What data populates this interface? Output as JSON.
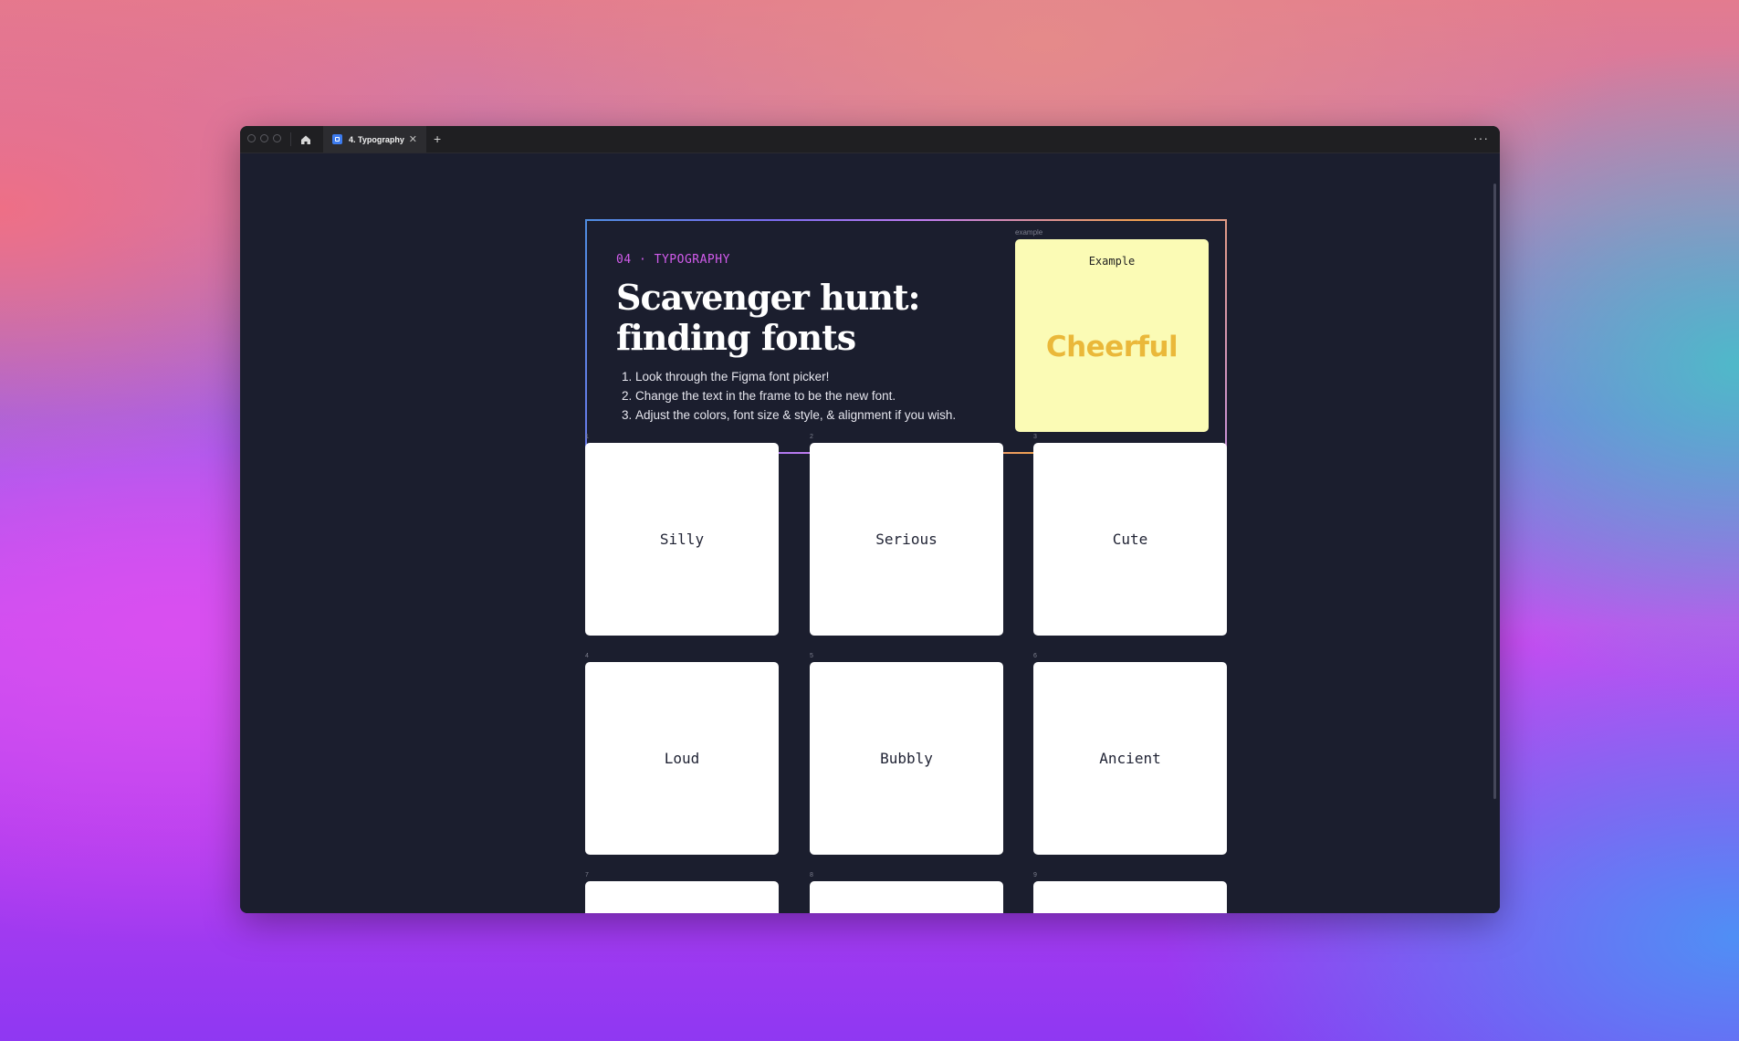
{
  "tab": {
    "title": "4. Typography",
    "close": "✕"
  },
  "toolbar": {
    "new_tab": "+",
    "menu": "···"
  },
  "hero": {
    "kicker": "04 · TYPOGRAPHY",
    "title_line1": "Scavenger hunt:",
    "title_line2": "finding fonts",
    "steps": [
      "Look through the Figma font picker!",
      "Change the text in the frame to be the new font.",
      "Adjust the colors, font size & style, & alignment if you wish."
    ],
    "example_tag": "example",
    "example_heading": "Example",
    "example_word": "Cheerful"
  },
  "cards": [
    {
      "number": "1",
      "label": "Silly"
    },
    {
      "number": "2",
      "label": "Serious"
    },
    {
      "number": "3",
      "label": "Cute"
    },
    {
      "number": "4",
      "label": "Loud"
    },
    {
      "number": "5",
      "label": "Bubbly"
    },
    {
      "number": "6",
      "label": "Ancient"
    },
    {
      "number": "7",
      "label": ""
    },
    {
      "number": "8",
      "label": ""
    },
    {
      "number": "9",
      "label": ""
    }
  ],
  "colors": {
    "canvas": "#1b1e2e",
    "kicker": "#d25cec",
    "example_bg": "#fbfbb5",
    "example_word": "#eab83a",
    "card_bg": "#ffffff"
  },
  "icons": [
    "home-icon",
    "figma-file-icon",
    "close-icon",
    "plus-icon",
    "more-icon"
  ]
}
